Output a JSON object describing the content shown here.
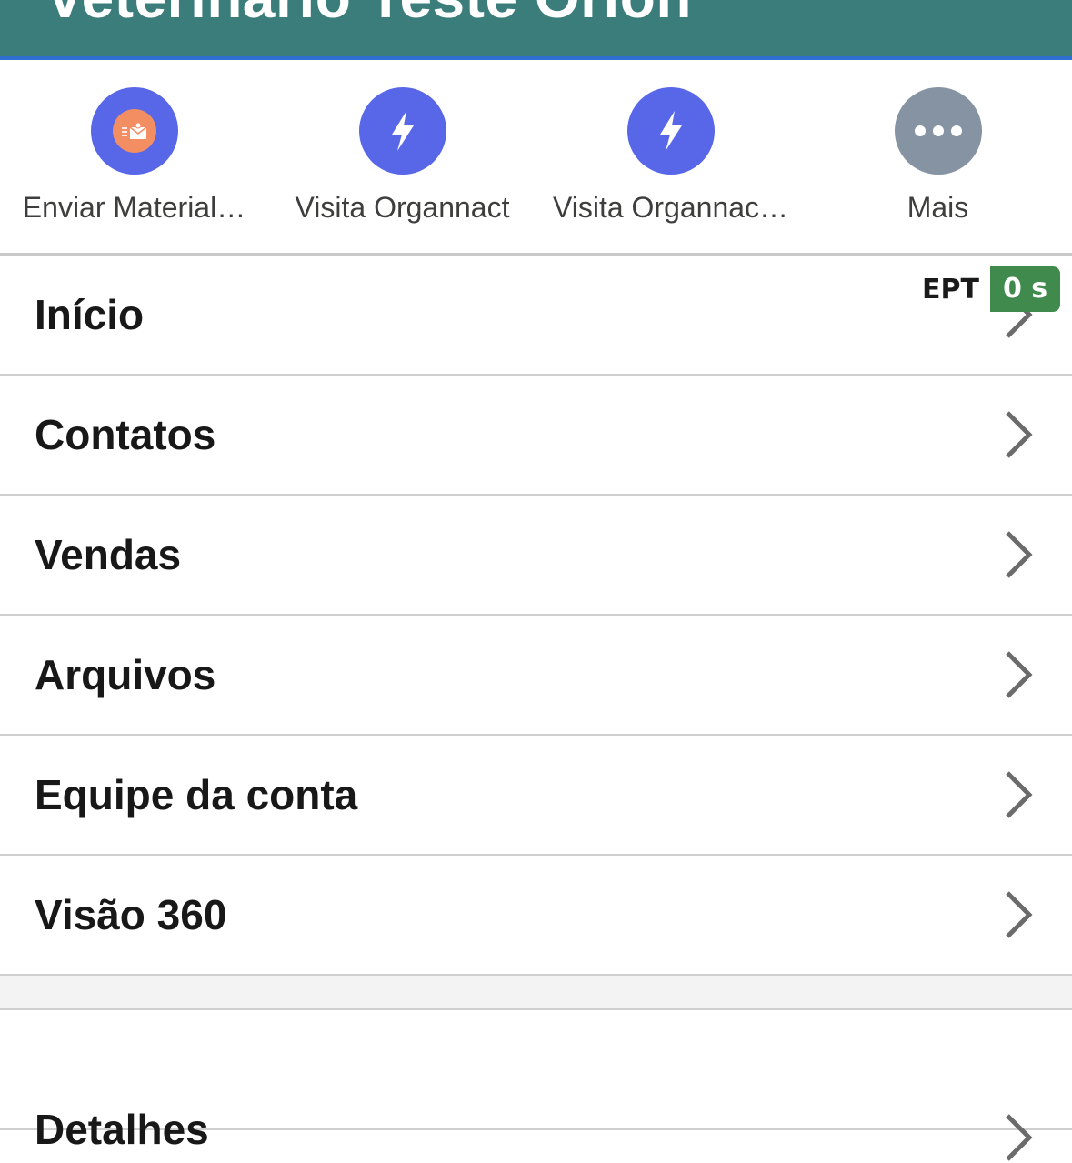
{
  "header": {
    "title": "Veterinário Teste Orion"
  },
  "actions": [
    {
      "label": "Enviar Material…",
      "icon": "send-material-icon",
      "color": "#5867e8",
      "inner_color": "#f38d62"
    },
    {
      "label": "Visita Organnact",
      "icon": "lightning-icon",
      "color": "#5867e8"
    },
    {
      "label": "Visita Organnac…",
      "icon": "lightning-icon",
      "color": "#5867e8"
    },
    {
      "label": "Mais",
      "icon": "more-icon",
      "color": "#8593a3"
    }
  ],
  "menu": {
    "items": [
      {
        "label": "Início"
      },
      {
        "label": "Contatos"
      },
      {
        "label": "Vendas"
      },
      {
        "label": "Arquivos"
      },
      {
        "label": "Equipe da conta"
      },
      {
        "label": "Visão 360"
      }
    ],
    "details_label": "Detalhes"
  },
  "ept": {
    "label": "EPT",
    "value": "0 s",
    "color": "#3f8a4c"
  },
  "theme": {
    "header_color": "#3a7d7a",
    "accent_line": "#2f6fd0"
  }
}
